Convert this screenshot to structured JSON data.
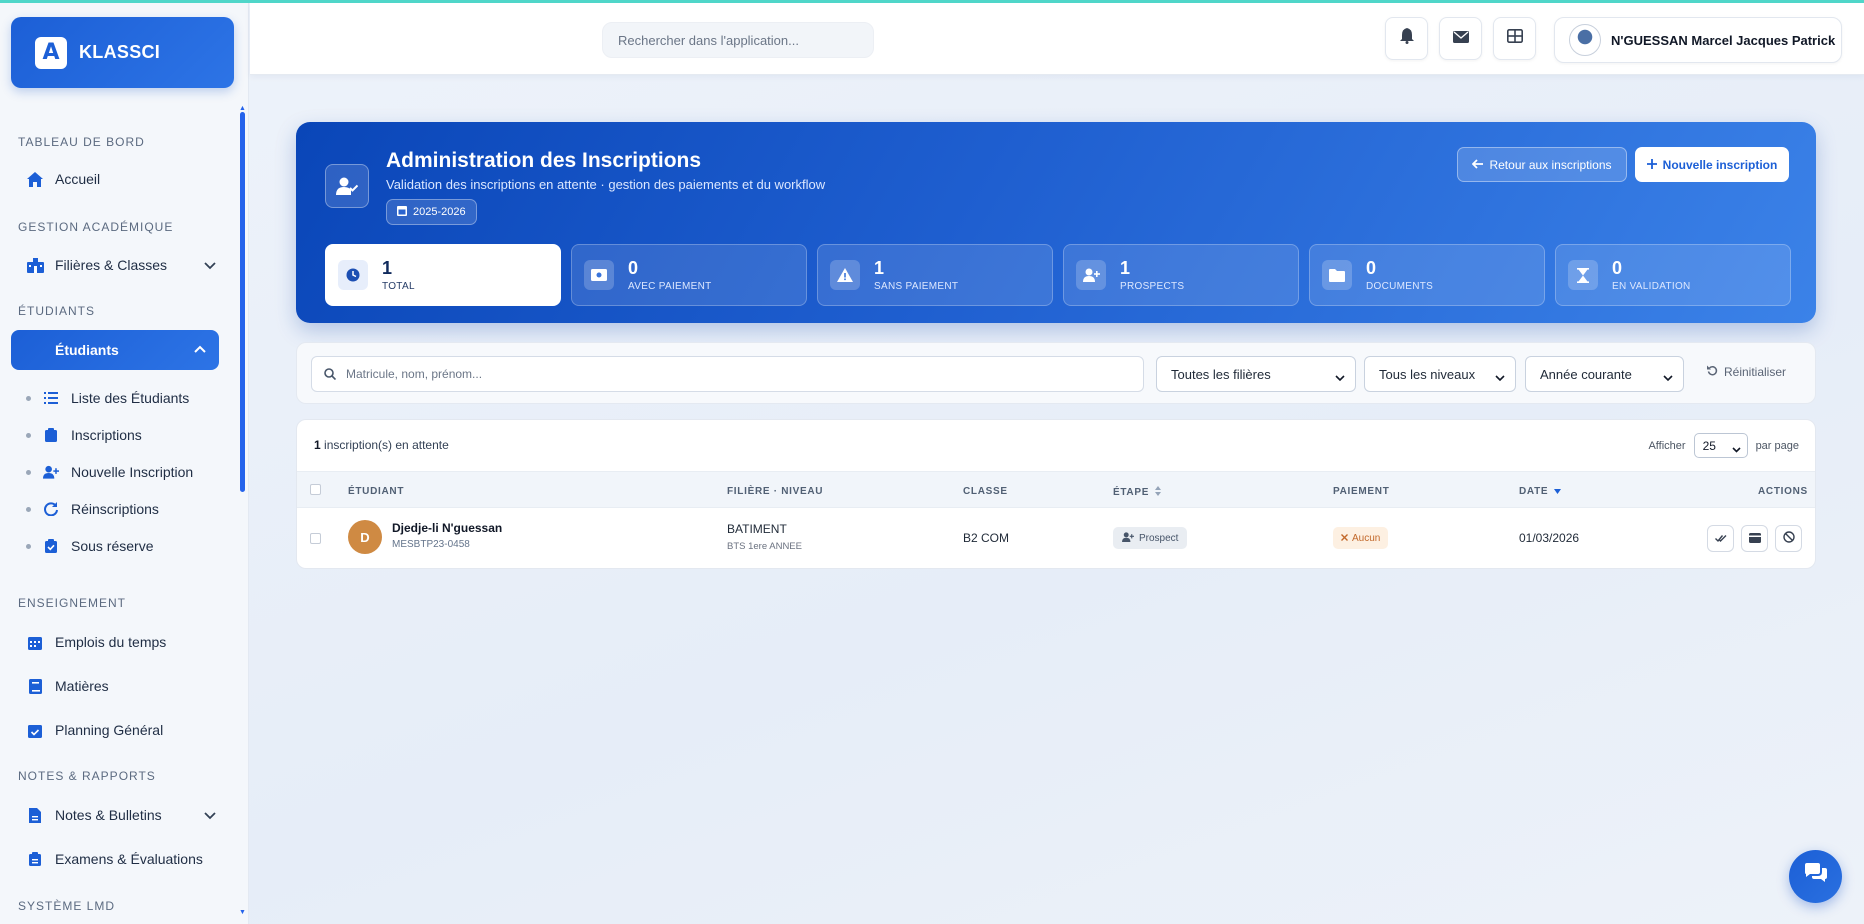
{
  "brand": {
    "name": "KLASSCI",
    "logo_letter": "A"
  },
  "sidebar": {
    "sections": {
      "dashboard": "TABLEAU DE BORD",
      "academic": "GESTION ACADÉMIQUE",
      "students": "ÉTUDIANTS",
      "teaching": "ENSEIGNEMENT",
      "notes": "NOTES & RAPPORTS",
      "lmd": "SYSTÈME LMD"
    },
    "items": {
      "home": "Accueil",
      "filieres": "Filières & Classes",
      "etudiants": "Étudiants",
      "emplois": "Emplois du temps",
      "matieres": "Matières",
      "planning": "Planning Général",
      "notes_bulletins": "Notes & Bulletins",
      "examens": "Examens & Évaluations"
    },
    "subitems": {
      "liste": "Liste des Étudiants",
      "inscriptions": "Inscriptions",
      "nouvelle": "Nouvelle Inscription",
      "reinscriptions": "Réinscriptions",
      "sous_reserve": "Sous réserve"
    }
  },
  "header": {
    "search_placeholder": "Rechercher dans l'application...",
    "user_name": "N'GUESSAN Marcel Jacques Patrick"
  },
  "hero": {
    "title": "Administration des Inscriptions",
    "subtitle": "Validation des inscriptions en attente · gestion des paiements et du workflow",
    "year": "2025-2026",
    "back_label": "Retour aux inscriptions",
    "new_label": "Nouvelle inscription",
    "stats": [
      {
        "value": "1",
        "label": "TOTAL",
        "icon": "clock-icon"
      },
      {
        "value": "0",
        "label": "AVEC PAIEMENT",
        "icon": "money-icon"
      },
      {
        "value": "1",
        "label": "SANS PAIEMENT",
        "icon": "warning-icon"
      },
      {
        "value": "1",
        "label": "PROSPECTS",
        "icon": "user-plus-icon"
      },
      {
        "value": "0",
        "label": "DOCUMENTS",
        "icon": "folder-icon"
      },
      {
        "value": "0",
        "label": "EN VALIDATION",
        "icon": "hourglass-icon"
      }
    ]
  },
  "filters": {
    "search_placeholder": "Matricule, nom, prénom...",
    "filiere": "Toutes les filières",
    "niveau": "Tous les niveaux",
    "annee": "Année courante",
    "reset": "Réinitialiser"
  },
  "table": {
    "count": "1",
    "count_suffix": "inscription(s) en attente",
    "show_label": "Afficher",
    "per_page_value": "25",
    "per_page_suffix": "par page",
    "columns": {
      "etudiant": "ÉTUDIANT",
      "filiere": "FILIÈRE · NIVEAU",
      "classe": "CLASSE",
      "etape": "ÉTAPE",
      "paiement": "PAIEMENT",
      "date": "DATE",
      "actions": "ACTIONS"
    },
    "rows": [
      {
        "initial": "D",
        "name": "Djedje-li N'guessan",
        "matricule": "MESBTP23-0458",
        "filiere": "BATIMENT",
        "niveau": "BTS 1ere ANNEE",
        "classe": "B2 COM",
        "etape": "Prospect",
        "paiement": "Aucun",
        "date": "01/03/2026"
      }
    ]
  },
  "colors": {
    "primary": "#1c5fd6",
    "accent_line": "#4fd6c9",
    "avatar": "#cf8a43",
    "payment_none": "#c2682a"
  }
}
